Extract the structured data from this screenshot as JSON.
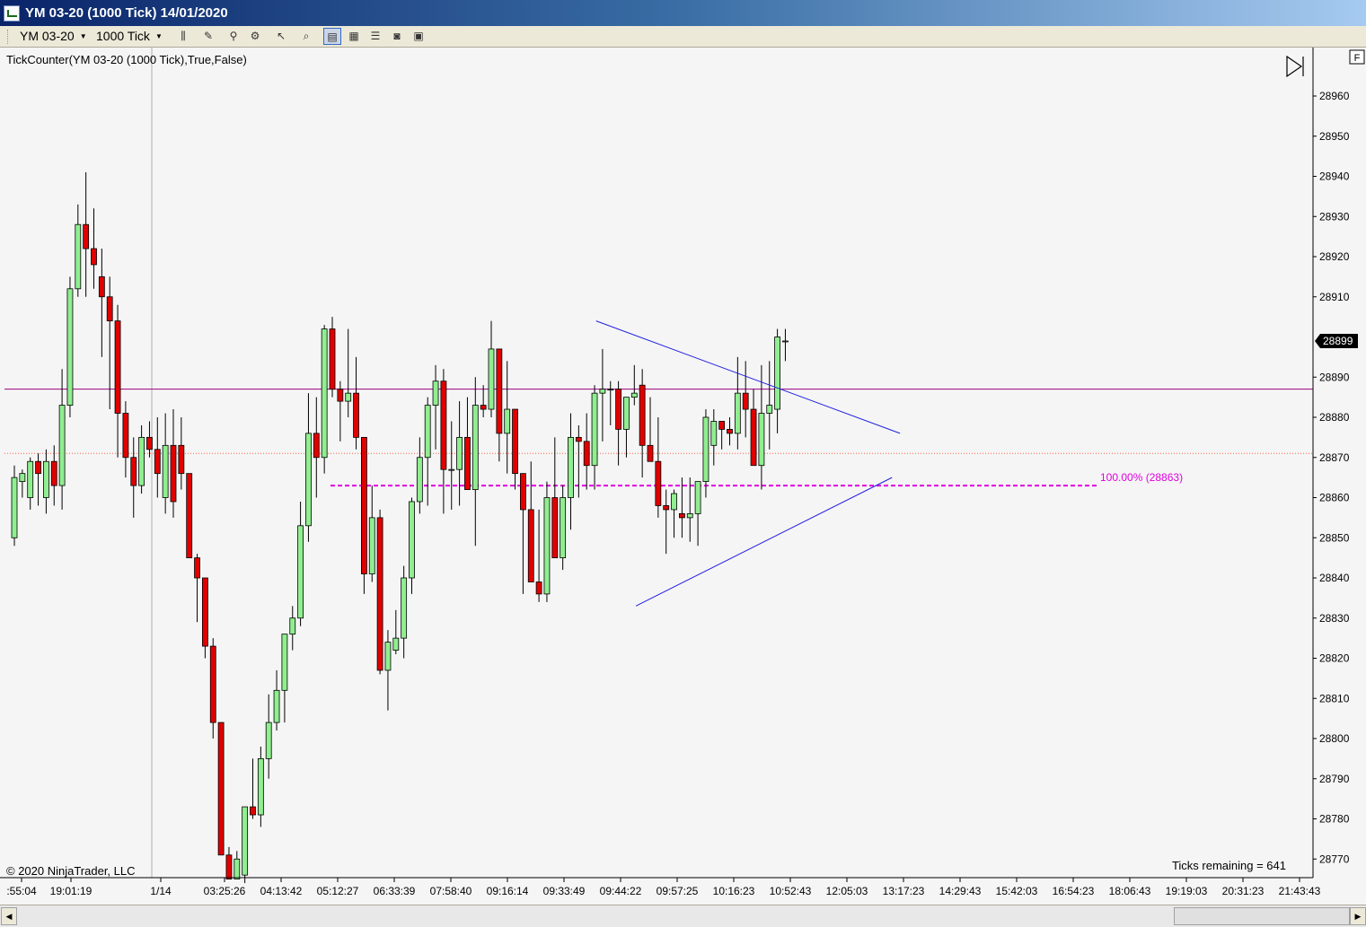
{
  "window": {
    "title": "YM 03-20 (1000 Tick)  14/01/2020"
  },
  "toolbar": {
    "instrument": "YM 03-20",
    "interval": "1000 Tick",
    "buttons": [
      {
        "name": "bar-type-button",
        "icon": "candlestick-icon",
        "active": false,
        "dropdown": true
      },
      {
        "name": "drawing-tools-button",
        "icon": "pencil-icon",
        "active": false,
        "dropdown": true
      },
      {
        "name": "indicators-button",
        "icon": "indicator-icon",
        "active": false,
        "dropdown": false
      },
      {
        "name": "strategies-button",
        "icon": "strategy-icon",
        "active": false,
        "dropdown": false
      },
      {
        "name": "cursor-mode-button",
        "icon": "cursor-icon",
        "active": false,
        "dropdown": true
      },
      {
        "name": "zoom-button",
        "icon": "magnifier-icon",
        "active": false,
        "dropdown": false
      },
      {
        "name": "chart-trader-button",
        "icon": "chart-trader-icon",
        "active": true,
        "dropdown": false
      },
      {
        "name": "data-box-button",
        "icon": "data-box-icon",
        "active": false,
        "dropdown": false
      },
      {
        "name": "properties-button",
        "icon": "properties-icon",
        "active": false,
        "dropdown": false
      },
      {
        "name": "snapshot-button",
        "icon": "camera-icon",
        "active": false,
        "dropdown": false
      },
      {
        "name": "templates-button",
        "icon": "template-icon",
        "active": false,
        "dropdown": false
      }
    ]
  },
  "chart": {
    "indicator_label": "TickCounter(YM 03-20 (1000 Tick),True,False)",
    "copyright": "© 2020 NinjaTrader, LLC",
    "ticks_remaining": "Ticks remaining = 641",
    "last_price_label": "28899",
    "fib_label": "100.00% (28863)",
    "panel_button": "F",
    "colors": {
      "background": "#f5f5f5",
      "up_candle": "#90ee90",
      "down_candle": "#e00000",
      "wick": "#000000",
      "horizontal_line": "#9b0080",
      "dotted_line": "#ff6347",
      "fib_line": "#e000e0",
      "trend_lines": "#2020e0"
    }
  },
  "chart_data": {
    "type": "candlestick",
    "y_axis": {
      "min": 28765,
      "max": 28970,
      "ticks": [
        28960,
        28950,
        28940,
        28930,
        28920,
        28910,
        28890,
        28880,
        28870,
        28860,
        28850,
        28840,
        28830,
        28820,
        28810,
        28800,
        28790,
        28780,
        28770
      ]
    },
    "x_axis": {
      "labels": [
        ":55:04",
        "19:01:19",
        "1/14",
        "03:25:26",
        "04:13:42",
        "05:12:27",
        "06:33:39",
        "07:58:40",
        "09:16:14",
        "09:33:49",
        "09:44:22",
        "09:57:25",
        "10:16:23",
        "10:52:43",
        "12:05:03",
        "13:17:23",
        "14:29:43",
        "15:42:03",
        "16:54:23",
        "18:06:43",
        "19:19:03",
        "20:31:23",
        "21:43:43"
      ]
    },
    "candles": [
      {
        "o": 28850,
        "h": 28868,
        "l": 28848,
        "c": 28865
      },
      {
        "o": 28864,
        "h": 28867,
        "l": 28860,
        "c": 28866
      },
      {
        "o": 28860,
        "h": 28870,
        "l": 28857,
        "c": 28869
      },
      {
        "o": 28869,
        "h": 28871,
        "l": 28858,
        "c": 28866
      },
      {
        "o": 28860,
        "h": 28872,
        "l": 28856,
        "c": 28869
      },
      {
        "o": 28869,
        "h": 28873,
        "l": 28858,
        "c": 28863
      },
      {
        "o": 28863,
        "h": 28892,
        "l": 28857,
        "c": 28883
      },
      {
        "o": 28883,
        "h": 28915,
        "l": 28880,
        "c": 28912
      },
      {
        "o": 28912,
        "h": 28933,
        "l": 28910,
        "c": 28928
      },
      {
        "o": 28928,
        "h": 28941,
        "l": 28910,
        "c": 28922
      },
      {
        "o": 28922,
        "h": 28932,
        "l": 28912,
        "c": 28918
      },
      {
        "o": 28915,
        "h": 28922,
        "l": 28895,
        "c": 28910
      },
      {
        "o": 28910,
        "h": 28915,
        "l": 28882,
        "c": 28904
      },
      {
        "o": 28904,
        "h": 28908,
        "l": 28870,
        "c": 28881
      },
      {
        "o": 28881,
        "h": 28884,
        "l": 28865,
        "c": 28870
      },
      {
        "o": 28870,
        "h": 28875,
        "l": 28855,
        "c": 28863
      },
      {
        "o": 28863,
        "h": 28878,
        "l": 28861,
        "c": 28875
      },
      {
        "o": 28875,
        "h": 28879,
        "l": 28870,
        "c": 28872
      },
      {
        "o": 28872,
        "h": 28880,
        "l": 28860,
        "c": 28866
      },
      {
        "o": 28860,
        "h": 28881,
        "l": 28856,
        "c": 28873
      },
      {
        "o": 28873,
        "h": 28882,
        "l": 28855,
        "c": 28859
      },
      {
        "o": 28873,
        "h": 28880,
        "l": 28862,
        "c": 28866
      },
      {
        "o": 28866,
        "h": 28866,
        "l": 28845,
        "c": 28845
      },
      {
        "o": 28845,
        "h": 28846,
        "l": 28829,
        "c": 28840
      },
      {
        "o": 28840,
        "h": 28836,
        "l": 28820,
        "c": 28823
      },
      {
        "o": 28823,
        "h": 28825,
        "l": 28800,
        "c": 28804
      },
      {
        "o": 28804,
        "h": 28803,
        "l": 28780,
        "c": 28771
      },
      {
        "o": 28771,
        "h": 28773,
        "l": 28765,
        "c": 28765
      },
      {
        "o": 28765,
        "h": 28772,
        "l": 28767,
        "c": 28770
      },
      {
        "o": 28766,
        "h": 28783,
        "l": 28764,
        "c": 28783
      },
      {
        "o": 28783,
        "h": 28795,
        "l": 28780,
        "c": 28781
      },
      {
        "o": 28781,
        "h": 28798,
        "l": 28778,
        "c": 28795
      },
      {
        "o": 28795,
        "h": 28811,
        "l": 28790,
        "c": 28804
      },
      {
        "o": 28804,
        "h": 28817,
        "l": 28802,
        "c": 28812
      },
      {
        "o": 28812,
        "h": 28826,
        "l": 28804,
        "c": 28826
      },
      {
        "o": 28826,
        "h": 28833,
        "l": 28822,
        "c": 28830
      },
      {
        "o": 28830,
        "h": 28859,
        "l": 28828,
        "c": 28853
      },
      {
        "o": 28853,
        "h": 28886,
        "l": 28849,
        "c": 28876
      },
      {
        "o": 28876,
        "h": 28885,
        "l": 28860,
        "c": 28870
      },
      {
        "o": 28870,
        "h": 28903,
        "l": 28866,
        "c": 28902
      },
      {
        "o": 28902,
        "h": 28905,
        "l": 28885,
        "c": 28887
      },
      {
        "o": 28887,
        "h": 28889,
        "l": 28874,
        "c": 28884
      },
      {
        "o": 28884,
        "h": 28902,
        "l": 28880,
        "c": 28886
      },
      {
        "o": 28886,
        "h": 28895,
        "l": 28872,
        "c": 28875
      },
      {
        "o": 28875,
        "h": 28873,
        "l": 28836,
        "c": 28841
      },
      {
        "o": 28841,
        "h": 28863,
        "l": 28839,
        "c": 28855
      },
      {
        "o": 28855,
        "h": 28857,
        "l": 28816,
        "c": 28817
      },
      {
        "o": 28817,
        "h": 28827,
        "l": 28807,
        "c": 28824
      },
      {
        "o": 28822,
        "h": 28832,
        "l": 28821,
        "c": 28825
      },
      {
        "o": 28825,
        "h": 28843,
        "l": 28820,
        "c": 28840
      },
      {
        "o": 28840,
        "h": 28860,
        "l": 28836,
        "c": 28859
      },
      {
        "o": 28859,
        "h": 28875,
        "l": 28856,
        "c": 28870
      },
      {
        "o": 28870,
        "h": 28885,
        "l": 28858,
        "c": 28883
      },
      {
        "o": 28883,
        "h": 28893,
        "l": 28872,
        "c": 28889
      },
      {
        "o": 28889,
        "h": 28892,
        "l": 28856,
        "c": 28867
      },
      {
        "o": 28867,
        "h": 28879,
        "l": 28857,
        "c": 28867
      },
      {
        "o": 28867,
        "h": 28884,
        "l": 28858,
        "c": 28875
      },
      {
        "o": 28875,
        "h": 28885,
        "l": 28862,
        "c": 28862
      },
      {
        "o": 28862,
        "h": 28890,
        "l": 28848,
        "c": 28883
      },
      {
        "o": 28883,
        "h": 28888,
        "l": 28880,
        "c": 28882
      },
      {
        "o": 28882,
        "h": 28904,
        "l": 28880,
        "c": 28897
      },
      {
        "o": 28897,
        "h": 28891,
        "l": 28869,
        "c": 28876
      },
      {
        "o": 28876,
        "h": 28894,
        "l": 28866,
        "c": 28882
      },
      {
        "o": 28882,
        "h": 28882,
        "l": 28862,
        "c": 28866
      },
      {
        "o": 28866,
        "h": 28860,
        "l": 28836,
        "c": 28857
      },
      {
        "o": 28857,
        "h": 28869,
        "l": 28848,
        "c": 28839
      },
      {
        "o": 28839,
        "h": 28857,
        "l": 28834,
        "c": 28836
      },
      {
        "o": 28836,
        "h": 28864,
        "l": 28834,
        "c": 28860
      },
      {
        "o": 28860,
        "h": 28875,
        "l": 28850,
        "c": 28845
      },
      {
        "o": 28845,
        "h": 28863,
        "l": 28842,
        "c": 28860
      },
      {
        "o": 28860,
        "h": 28881,
        "l": 28852,
        "c": 28875
      },
      {
        "o": 28875,
        "h": 28878,
        "l": 28860,
        "c": 28874
      },
      {
        "o": 28874,
        "h": 28881,
        "l": 28862,
        "c": 28868
      },
      {
        "o": 28868,
        "h": 28888,
        "l": 28862,
        "c": 28886
      },
      {
        "o": 28886,
        "h": 28897,
        "l": 28874,
        "c": 28887
      },
      {
        "o": 28887,
        "h": 28889,
        "l": 28878,
        "c": 28887
      },
      {
        "o": 28887,
        "h": 28889,
        "l": 28868,
        "c": 28877
      },
      {
        "o": 28877,
        "h": 28882,
        "l": 28870,
        "c": 28885
      },
      {
        "o": 28885,
        "h": 28893,
        "l": 28883,
        "c": 28886
      },
      {
        "o": 28888,
        "h": 28892,
        "l": 28865,
        "c": 28873
      },
      {
        "o": 28873,
        "h": 28885,
        "l": 28869,
        "c": 28869
      },
      {
        "o": 28869,
        "h": 28880,
        "l": 28855,
        "c": 28858
      },
      {
        "o": 28858,
        "h": 28862,
        "l": 28846,
        "c": 28857
      },
      {
        "o": 28857,
        "h": 28862,
        "l": 28850,
        "c": 28861
      },
      {
        "o": 28856,
        "h": 28865,
        "l": 28850,
        "c": 28855
      },
      {
        "o": 28855,
        "h": 28865,
        "l": 28849,
        "c": 28856
      },
      {
        "o": 28856,
        "h": 28864,
        "l": 28848,
        "c": 28864
      },
      {
        "o": 28864,
        "h": 28882,
        "l": 28860,
        "c": 28880
      },
      {
        "o": 28873,
        "h": 28882,
        "l": 28868,
        "c": 28879
      },
      {
        "o": 28879,
        "h": 28878,
        "l": 28872,
        "c": 28877
      },
      {
        "o": 28877,
        "h": 28880,
        "l": 28873,
        "c": 28876
      },
      {
        "o": 28876,
        "h": 28895,
        "l": 28872,
        "c": 28886
      },
      {
        "o": 28886,
        "h": 28894,
        "l": 28875,
        "c": 28882
      },
      {
        "o": 28882,
        "h": 28887,
        "l": 28868,
        "c": 28868
      },
      {
        "o": 28868,
        "h": 28893,
        "l": 28862,
        "c": 28881
      },
      {
        "o": 28881,
        "h": 28894,
        "l": 28872,
        "c": 28883
      },
      {
        "o": 28882,
        "h": 28902,
        "l": 28876,
        "c": 28900
      },
      {
        "o": 28899,
        "h": 28902,
        "l": 28894,
        "c": 28899
      }
    ],
    "horizontal_line": 28887,
    "dotted_line": 28871,
    "fib_level": {
      "label": "100.00%",
      "value": 28863
    },
    "trend_lines": [
      {
        "from_index": 75,
        "from_value": 28904,
        "to_index": 126,
        "to_value": 28876
      },
      {
        "from_index": 80,
        "from_value": 28833,
        "to_index": 125,
        "to_value": 28865
      }
    ]
  }
}
